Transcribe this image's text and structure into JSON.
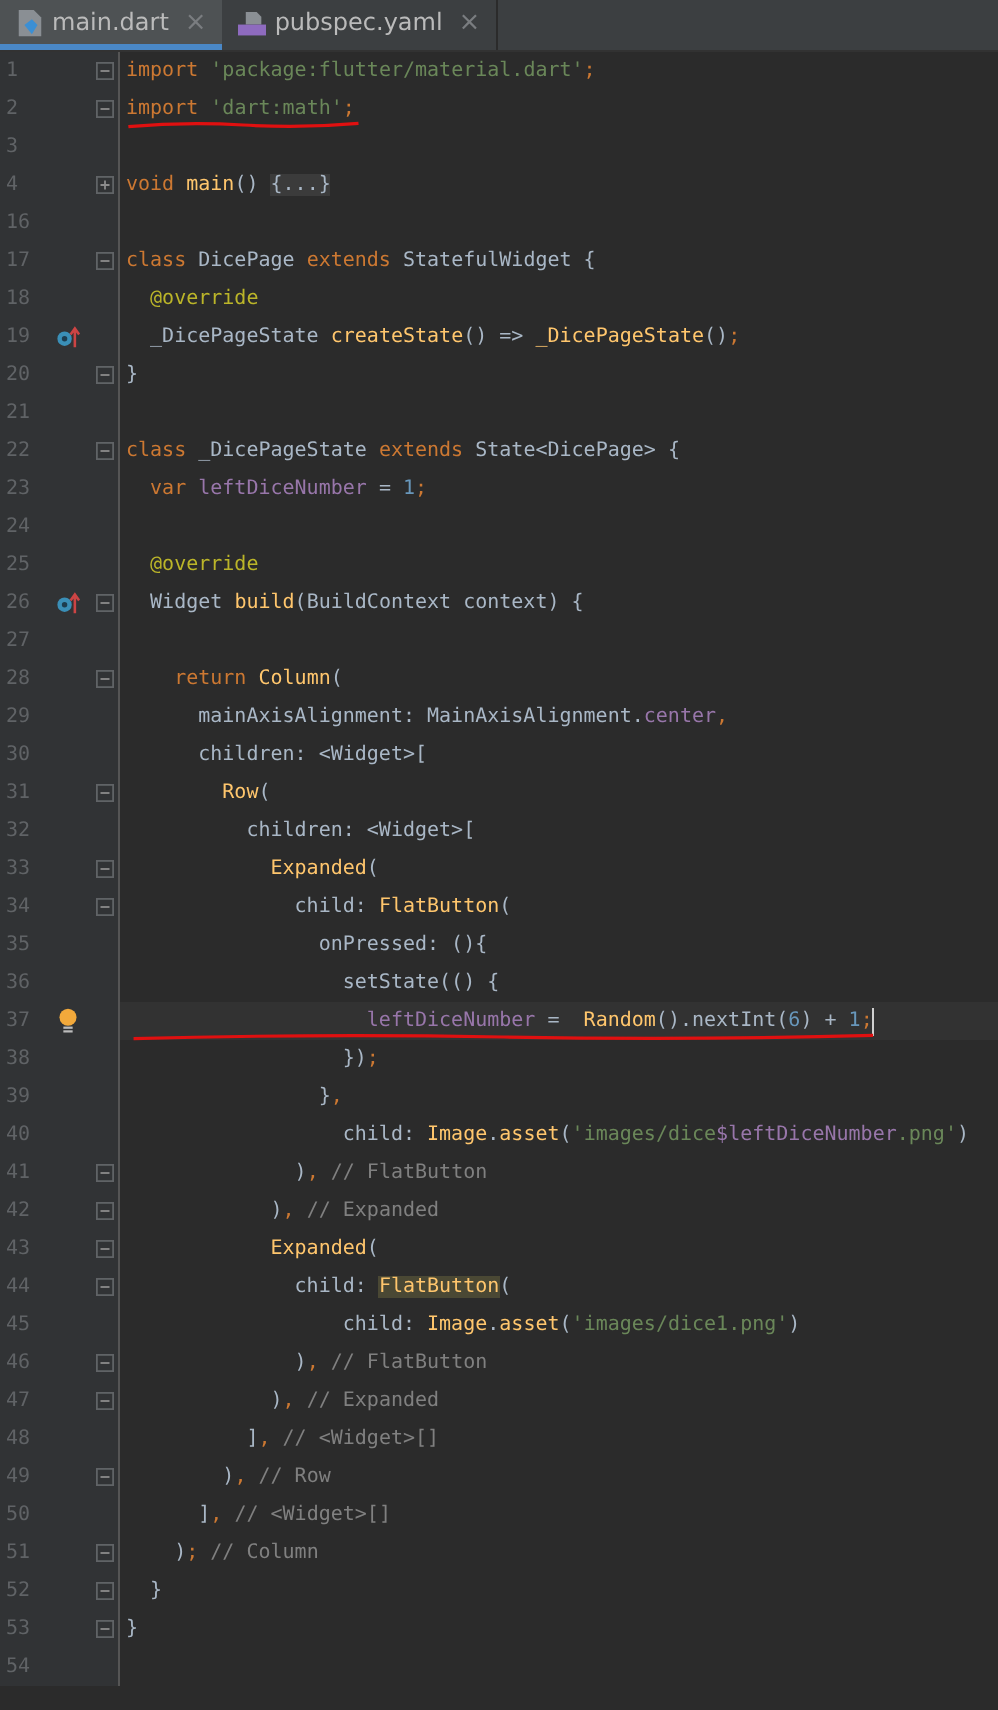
{
  "tabs": [
    {
      "label": "main.dart",
      "kind": "dart",
      "selected": true,
      "close": "×"
    },
    {
      "label": "pubspec.yaml",
      "kind": "yaml",
      "selected": false,
      "close": "×"
    }
  ],
  "lines": [
    {
      "n": "1",
      "expanded": true,
      "tokens": [
        {
          "kind": "kw",
          "text": "import "
        },
        {
          "kind": "str",
          "text": "'package:flutter/material.dart'"
        },
        {
          "kind": "kw",
          "text": ";"
        }
      ]
    },
    {
      "n": "2",
      "expanded": true,
      "underlined": true,
      "tokens": [
        {
          "kind": "kw",
          "text": "import "
        },
        {
          "kind": "str",
          "text": "'dart:math'"
        },
        {
          "kind": "kw",
          "text": ";"
        }
      ]
    },
    {
      "n": "3"
    },
    {
      "n": "4",
      "expanded": false,
      "tokens": [
        {
          "kind": "kw",
          "text": "void "
        },
        {
          "kind": "fn",
          "text": "main"
        },
        {
          "kind": "p",
          "text": "() "
        },
        {
          "kind": "folded",
          "text": "{...}"
        }
      ]
    },
    {
      "n": "16"
    },
    {
      "n": "17",
      "expanded": true,
      "tokens": [
        {
          "kind": "kw",
          "text": "class "
        },
        {
          "kind": "p",
          "text": "DicePage "
        },
        {
          "kind": "kw",
          "text": "extends "
        },
        {
          "kind": "p",
          "text": "StatefulWidget {"
        }
      ]
    },
    {
      "n": "18",
      "tokens": [
        {
          "kind": "ann",
          "text": "  @override"
        }
      ]
    },
    {
      "n": "19",
      "kind": "override",
      "tokens": [
        {
          "kind": "p",
          "text": "  _DicePageState "
        },
        {
          "kind": "fn",
          "text": "createState"
        },
        {
          "kind": "p",
          "text": "() => "
        },
        {
          "kind": "fn",
          "text": "_DicePageState"
        },
        {
          "kind": "p",
          "text": "()"
        },
        {
          "kind": "kw",
          "text": ";"
        }
      ]
    },
    {
      "n": "20",
      "expanded": true,
      "tokens": [
        {
          "kind": "p",
          "text": "}"
        }
      ]
    },
    {
      "n": "21"
    },
    {
      "n": "22",
      "expanded": true,
      "tokens": [
        {
          "kind": "kw",
          "text": "class "
        },
        {
          "kind": "p",
          "text": "_DicePageState "
        },
        {
          "kind": "kw",
          "text": "extends "
        },
        {
          "kind": "p",
          "text": "State<DicePage> {"
        }
      ]
    },
    {
      "n": "23",
      "tokens": [
        {
          "kind": "kw",
          "text": "  var "
        },
        {
          "kind": "field",
          "text": "leftDiceNumber"
        },
        {
          "kind": "p",
          "text": " = "
        },
        {
          "kind": "num",
          "text": "1"
        },
        {
          "kind": "kw",
          "text": ";"
        }
      ]
    },
    {
      "n": "24"
    },
    {
      "n": "25",
      "tokens": [
        {
          "kind": "ann",
          "text": "  @override"
        }
      ]
    },
    {
      "n": "26",
      "kind": "override",
      "expanded": true,
      "tokens": [
        {
          "kind": "p",
          "text": "  Widget "
        },
        {
          "kind": "fn",
          "text": "build"
        },
        {
          "kind": "p",
          "text": "(BuildContext context) {"
        }
      ]
    },
    {
      "n": "27"
    },
    {
      "n": "28",
      "expanded": true,
      "tokens": [
        {
          "kind": "kw",
          "text": "    return "
        },
        {
          "kind": "fn",
          "text": "Column"
        },
        {
          "kind": "p",
          "text": "("
        }
      ]
    },
    {
      "n": "29",
      "tokens": [
        {
          "kind": "p",
          "text": "      mainAxisAlignment: MainAxisAlignment."
        },
        {
          "kind": "field",
          "text": "center"
        },
        {
          "kind": "kw",
          "text": ","
        }
      ]
    },
    {
      "n": "30",
      "tokens": [
        {
          "kind": "p",
          "text": "      children: <Widget>["
        }
      ]
    },
    {
      "n": "31",
      "expanded": true,
      "tokens": [
        {
          "kind": "fn",
          "text": "        Row"
        },
        {
          "kind": "p",
          "text": "("
        }
      ]
    },
    {
      "n": "32",
      "tokens": [
        {
          "kind": "p",
          "text": "          children: <Widget>["
        }
      ]
    },
    {
      "n": "33",
      "expanded": true,
      "tokens": [
        {
          "kind": "fn",
          "text": "            Expanded"
        },
        {
          "kind": "p",
          "text": "("
        }
      ]
    },
    {
      "n": "34",
      "expanded": true,
      "tokens": [
        {
          "kind": "p",
          "text": "              child: "
        },
        {
          "kind": "fn",
          "text": "FlatButton"
        },
        {
          "kind": "p",
          "text": "("
        }
      ]
    },
    {
      "n": "35",
      "tokens": [
        {
          "kind": "p",
          "text": "                onPressed: (){"
        }
      ]
    },
    {
      "n": "36",
      "tokens": [
        {
          "kind": "p",
          "text": "                  setState(() {"
        }
      ]
    },
    {
      "n": "37",
      "kind": "bulb",
      "current": true,
      "underlined": true,
      "tokens": [
        {
          "kind": "field",
          "text": "                    leftDiceNumber"
        },
        {
          "kind": "p",
          "text": " =  "
        },
        {
          "kind": "fn",
          "text": "Random"
        },
        {
          "kind": "p",
          "text": "().nextInt("
        },
        {
          "kind": "num",
          "text": "6"
        },
        {
          "kind": "p",
          "text": ") + "
        },
        {
          "kind": "num",
          "text": "1"
        },
        {
          "kind": "kw",
          "text": ";"
        }
      ]
    },
    {
      "n": "38",
      "tokens": [
        {
          "kind": "p",
          "text": "                  })"
        },
        {
          "kind": "kw",
          "text": ";"
        }
      ]
    },
    {
      "n": "39",
      "tokens": [
        {
          "kind": "p",
          "text": "                }"
        },
        {
          "kind": "kw",
          "text": ","
        }
      ]
    },
    {
      "n": "40",
      "tokens": [
        {
          "kind": "p",
          "text": "                  child: "
        },
        {
          "kind": "fn",
          "text": "Image"
        },
        {
          "kind": "p",
          "text": "."
        },
        {
          "kind": "fn",
          "text": "asset"
        },
        {
          "kind": "p",
          "text": "("
        },
        {
          "kind": "str",
          "text": "'images/dice"
        },
        {
          "kind": "field",
          "text": "$leftDiceNumber"
        },
        {
          "kind": "str",
          "text": ".png'"
        },
        {
          "kind": "p",
          "text": ")"
        }
      ]
    },
    {
      "n": "41",
      "expanded": true,
      "tokens": [
        {
          "kind": "p",
          "text": "              )"
        },
        {
          "kind": "kw",
          "text": ","
        },
        {
          "kind": "cm",
          "text": " // FlatButton"
        }
      ]
    },
    {
      "n": "42",
      "expanded": true,
      "tokens": [
        {
          "kind": "p",
          "text": "            )"
        },
        {
          "kind": "kw",
          "text": ","
        },
        {
          "kind": "cm",
          "text": " // Expanded"
        }
      ]
    },
    {
      "n": "43",
      "expanded": true,
      "tokens": [
        {
          "kind": "fn",
          "text": "            Expanded"
        },
        {
          "kind": "p",
          "text": "("
        }
      ]
    },
    {
      "n": "44",
      "expanded": true,
      "tokens": [
        {
          "kind": "p",
          "text": "              child: "
        },
        {
          "kind": "hl",
          "text": "FlatButton"
        },
        {
          "kind": "p",
          "text": "("
        }
      ]
    },
    {
      "n": "45",
      "tokens": [
        {
          "kind": "p",
          "text": "                  child: "
        },
        {
          "kind": "fn",
          "text": "Image"
        },
        {
          "kind": "p",
          "text": "."
        },
        {
          "kind": "fn",
          "text": "asset"
        },
        {
          "kind": "p",
          "text": "("
        },
        {
          "kind": "str",
          "text": "'images/dice1.png'"
        },
        {
          "kind": "p",
          "text": ")"
        }
      ]
    },
    {
      "n": "46",
      "expanded": true,
      "tokens": [
        {
          "kind": "p",
          "text": "              )"
        },
        {
          "kind": "kw",
          "text": ","
        },
        {
          "kind": "cm",
          "text": " // FlatButton"
        }
      ]
    },
    {
      "n": "47",
      "expanded": true,
      "tokens": [
        {
          "kind": "p",
          "text": "            )"
        },
        {
          "kind": "kw",
          "text": ","
        },
        {
          "kind": "cm",
          "text": " // Expanded"
        }
      ]
    },
    {
      "n": "48",
      "tokens": [
        {
          "kind": "p",
          "text": "          ]"
        },
        {
          "kind": "kw",
          "text": ","
        },
        {
          "kind": "cm",
          "text": " // <Widget>[]"
        }
      ]
    },
    {
      "n": "49",
      "expanded": true,
      "tokens": [
        {
          "kind": "p",
          "text": "        )"
        },
        {
          "kind": "kw",
          "text": ","
        },
        {
          "kind": "cm",
          "text": " // Row"
        }
      ]
    },
    {
      "n": "50",
      "tokens": [
        {
          "kind": "p",
          "text": "      ]"
        },
        {
          "kind": "kw",
          "text": ","
        },
        {
          "kind": "cm",
          "text": " // <Widget>[]"
        }
      ]
    },
    {
      "n": "51",
      "expanded": true,
      "tokens": [
        {
          "kind": "p",
          "text": "    )"
        },
        {
          "kind": "kw",
          "text": ";"
        },
        {
          "kind": "cm",
          "text": " // Column"
        }
      ]
    },
    {
      "n": "52",
      "expanded": true,
      "tokens": [
        {
          "kind": "p",
          "text": "  }"
        }
      ]
    },
    {
      "n": "53",
      "expanded": true,
      "tokens": [
        {
          "kind": "p",
          "text": "}"
        }
      ]
    },
    {
      "n": "54"
    }
  ]
}
